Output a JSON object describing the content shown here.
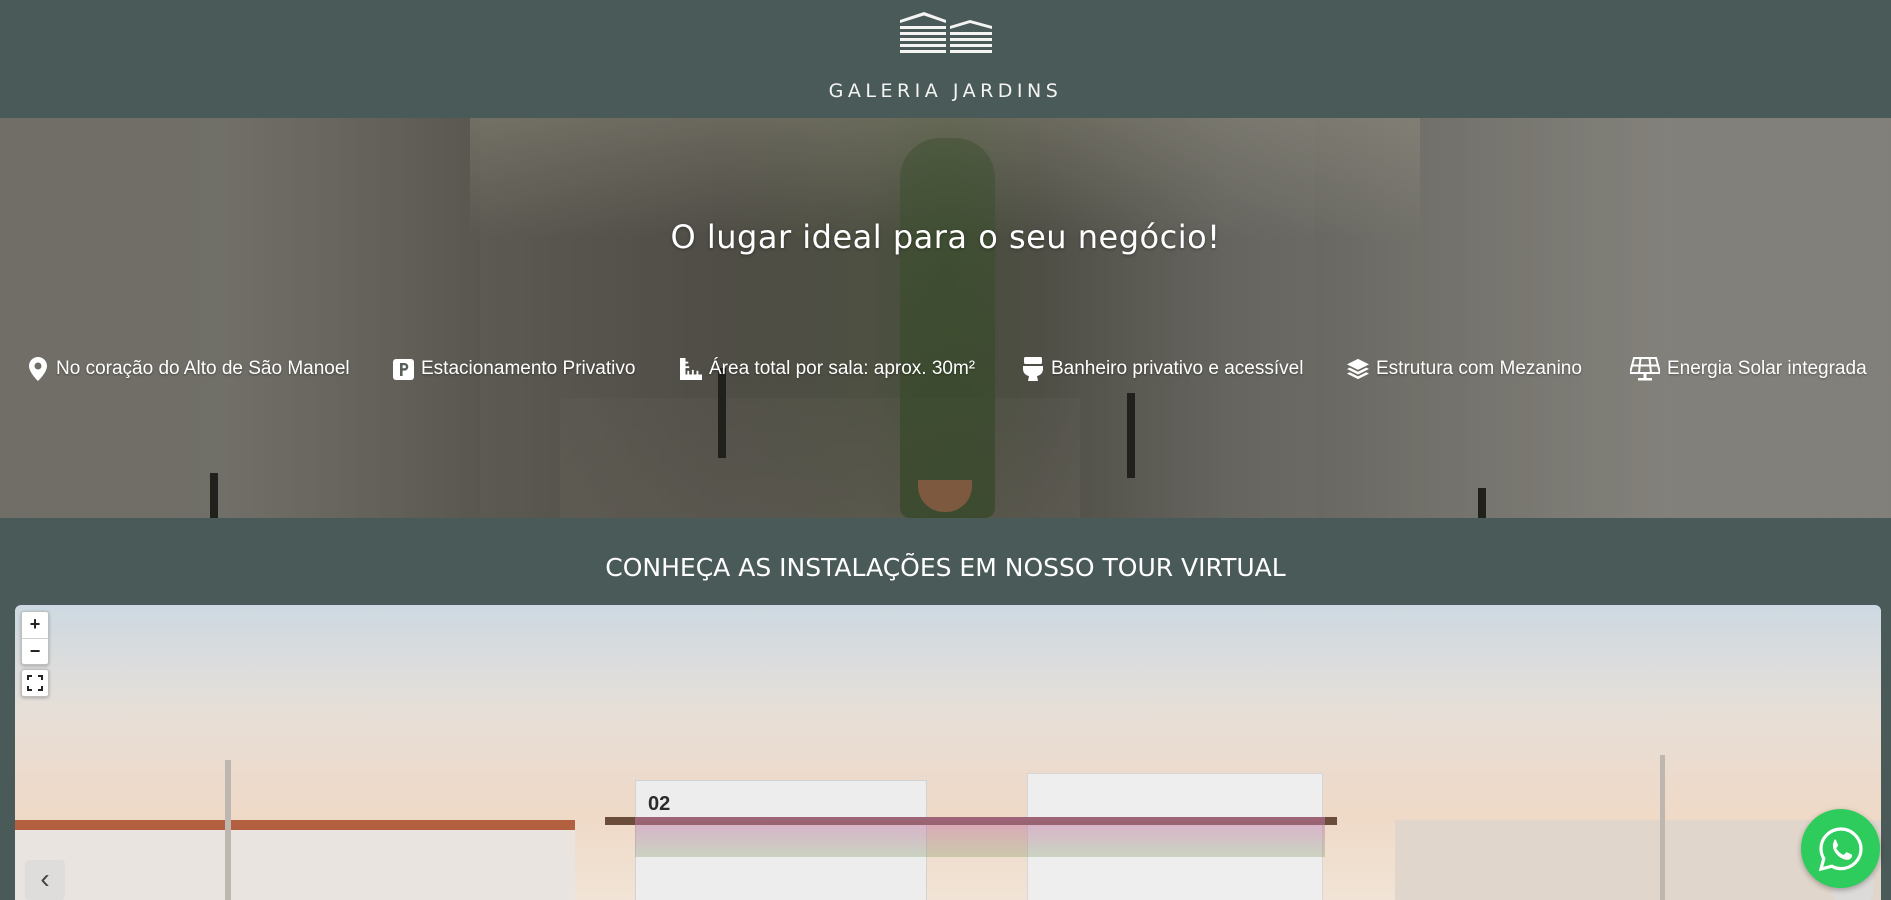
{
  "header": {
    "logo_text": "GALERIA JARDINS"
  },
  "hero": {
    "title": "O lugar ideal para o seu negócio!",
    "features": [
      {
        "icon": "map-pin-icon",
        "label": "No coração do Alto de São Manoel"
      },
      {
        "icon": "parking-icon",
        "label": "Estacionamento Privativo"
      },
      {
        "icon": "ruler-icon",
        "label": "Área total por sala: aprox. 30m²"
      },
      {
        "icon": "toilet-icon",
        "label": "Banheiro privativo e acessível"
      },
      {
        "icon": "layers-icon",
        "label": "Estrutura com Mezanino"
      },
      {
        "icon": "solar-panel-icon",
        "label": "Energia Solar integrada"
      }
    ]
  },
  "tour": {
    "title": "CONHEÇA AS INSTALAÇÕES EM NOSSO TOUR VIRTUAL",
    "zoom_in_label": "+",
    "zoom_out_label": "−",
    "prev_label": "‹",
    "next_label": "›",
    "building_number": "02"
  },
  "floating": {
    "whatsapp_icon": "whatsapp-icon"
  },
  "colors": {
    "background": "#4a5a58",
    "whatsapp": "#2ecc5c",
    "text": "#ffffff"
  }
}
